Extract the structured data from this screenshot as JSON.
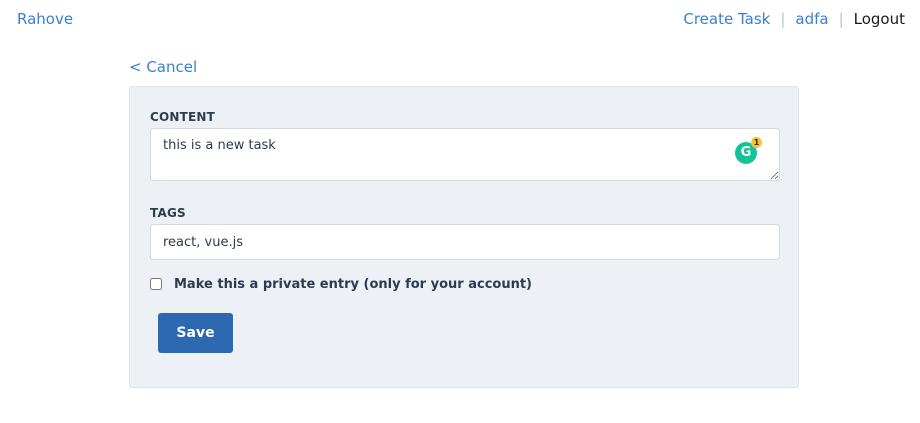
{
  "nav": {
    "brand": "Rahove",
    "create_task": "Create Task",
    "user": "adfa",
    "logout": "Logout",
    "separator": "|"
  },
  "cancel_link": "< Cancel",
  "form": {
    "content_label": "CONTENT",
    "content_value": "this is a new task",
    "tags_label": "TAGS",
    "tags_value": "react, vue.js",
    "private_label": "Make this a private entry (only for your account)",
    "private_checked": false,
    "save_label": "Save"
  },
  "grammarly": {
    "letter": "G",
    "count": "1"
  },
  "colors": {
    "link": "#3a7fd6",
    "panel_bg": "#edf1f6",
    "button": "#2c69b0",
    "grammarly": "#15c39a"
  }
}
